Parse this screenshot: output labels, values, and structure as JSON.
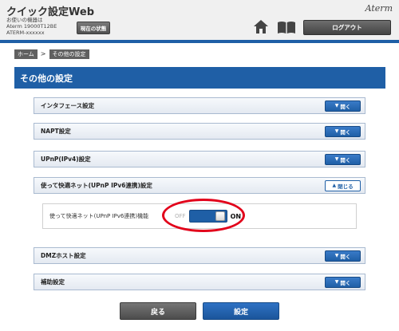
{
  "header": {
    "title": "クイック設定Web",
    "device_lines": [
      "お使いの機器は",
      "Aterm 19000T12BE",
      "ATERM-xxxxxx"
    ],
    "status_button": "現在の状態",
    "brand": "Aterm",
    "logout_button": "ログアウト"
  },
  "breadcrumb": {
    "home": "ホーム",
    "separator": ">",
    "current": "その他の設定"
  },
  "section": {
    "title": "その他の設定"
  },
  "panels": [
    {
      "label": "インタフェース設定",
      "button": "開く",
      "state": "collapsed"
    },
    {
      "label": "NAPT設定",
      "button": "開く",
      "state": "collapsed"
    },
    {
      "label": "UPnP(IPv4)設定",
      "button": "開く",
      "state": "collapsed"
    },
    {
      "label": "使って快適ネット(UPnP IPv6連携)設定",
      "button": "閉じる",
      "state": "expanded"
    },
    {
      "label": "DMZホスト設定",
      "button": "開く",
      "state": "collapsed"
    },
    {
      "label": "補助設定",
      "button": "開く",
      "state": "collapsed"
    }
  ],
  "upnp_ipv6": {
    "label": "使って快適ネット(UPnP IPv6連携)機能",
    "off_label": "OFF",
    "on_label": "ON",
    "enabled": true
  },
  "footer": {
    "back": "戻る",
    "save": "設定"
  },
  "colors": {
    "accent": "#1f5fa6",
    "highlight": "#e2001a",
    "dark_button": "#505050"
  }
}
